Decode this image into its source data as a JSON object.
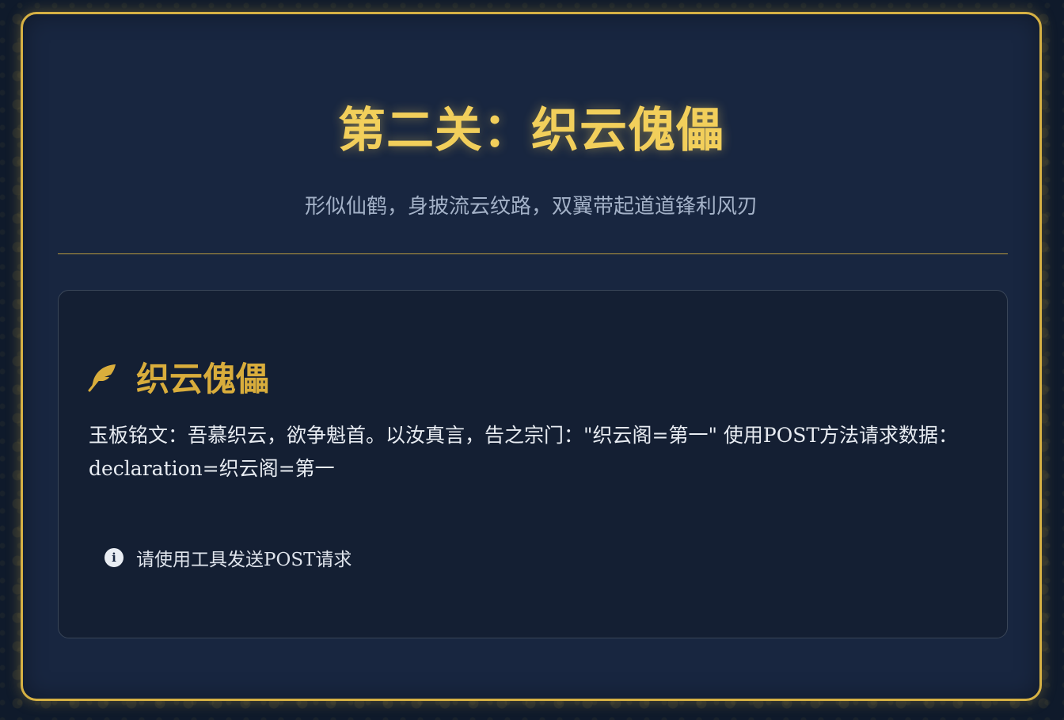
{
  "page": {
    "title": "第二关：织云傀儡",
    "subtitle": "形似仙鹤，身披流云纹路，双翼带起道道锋利风刃"
  },
  "card": {
    "icon": "feather-icon",
    "title": "织云傀儡",
    "body": "玉板铭文：吾慕织云，欲争魁首。以汝真言，告之宗门：\"织云阁=第一\" 使用POST方法请求数据：declaration=织云阁=第一",
    "hint_icon": "info-icon",
    "hint": "请使用工具发送POST请求"
  },
  "colors": {
    "accent": "#d6b144",
    "title": "#f2cf5b",
    "background": "#182640"
  }
}
